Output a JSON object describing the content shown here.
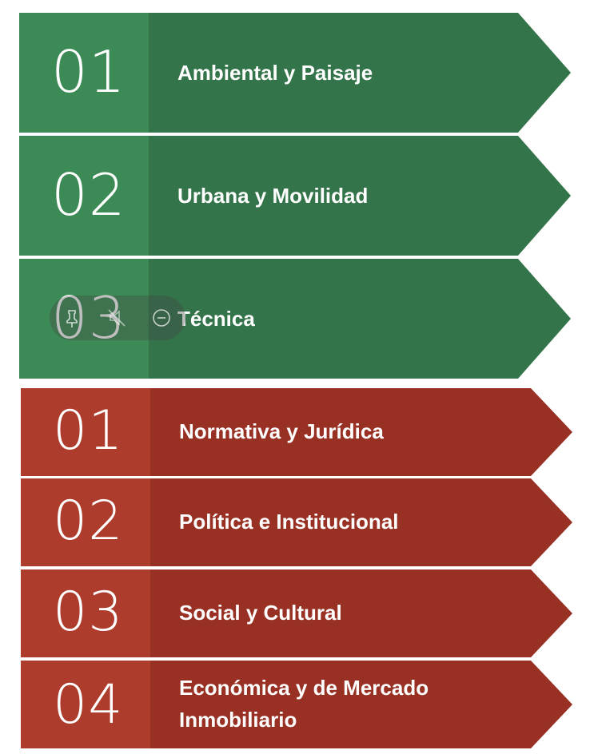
{
  "green_group": {
    "color": "#3a7a4a",
    "items": [
      {
        "number": "01",
        "label": "Ambiental y Paisaje"
      },
      {
        "number": "02",
        "label": "Urbana y Movilidad"
      },
      {
        "number": "03",
        "label": "Técnica"
      }
    ]
  },
  "red_group": {
    "color": "#a33a2c",
    "items": [
      {
        "number": "01",
        "label": "Normativa y Jurídica"
      },
      {
        "number": "02",
        "label": "Política e Institucional"
      },
      {
        "number": "03",
        "label": "Social y Cultural"
      },
      {
        "number": "04",
        "label": "Económica y de Mercado Inmobiliario"
      }
    ]
  },
  "overlay_toolbar": {
    "icons": [
      "pin-icon",
      "mute-icon",
      "minus-circle-icon"
    ]
  }
}
